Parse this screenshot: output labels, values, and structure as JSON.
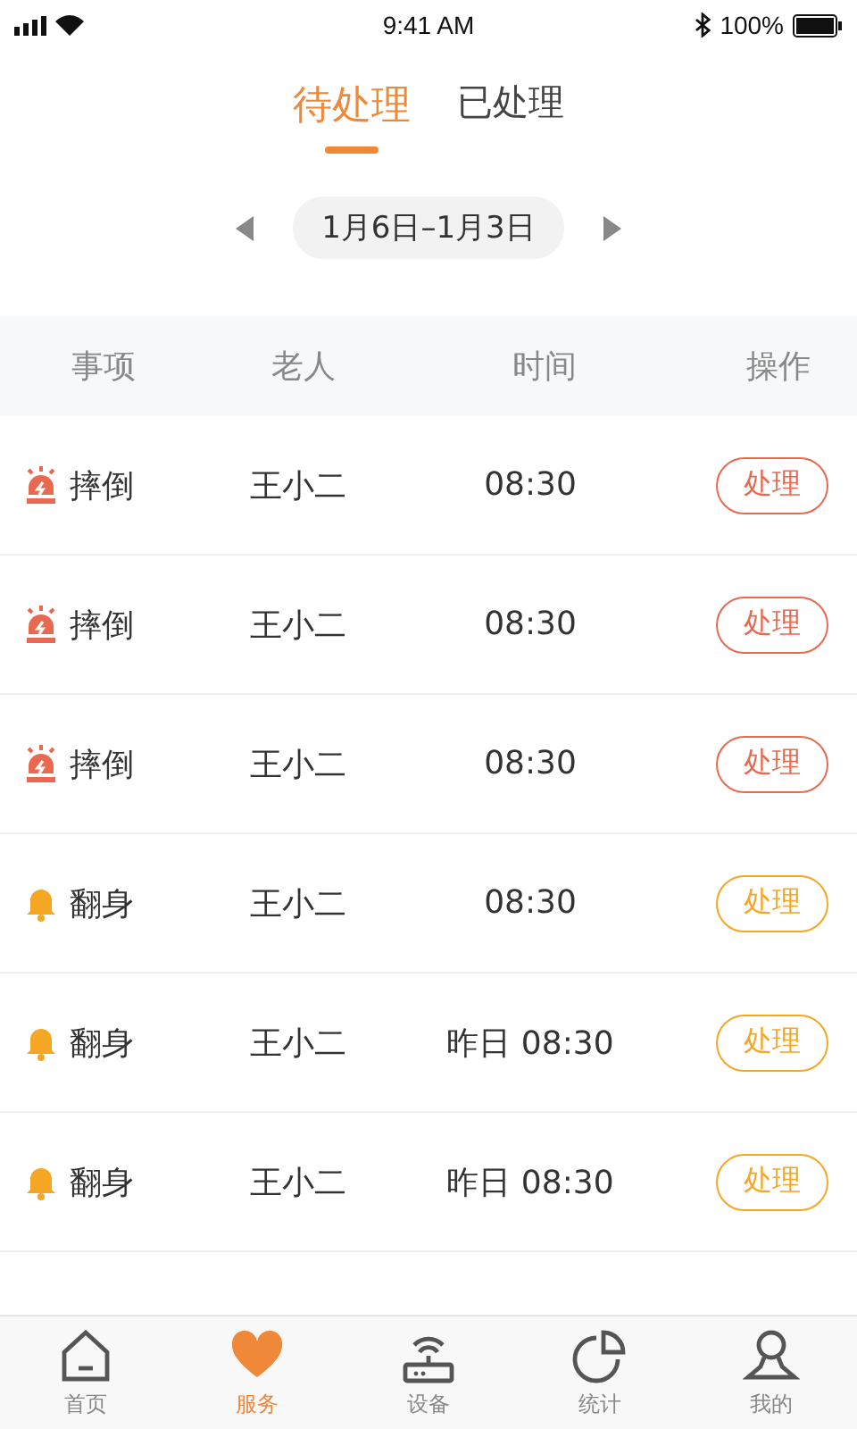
{
  "status_bar": {
    "time": "9:41 AM",
    "battery": "100%"
  },
  "tabs": [
    {
      "label": "待处理",
      "selected": true
    },
    {
      "label": "已处理",
      "selected": false
    }
  ],
  "date_range": {
    "label": "1月6日–1月3日"
  },
  "table": {
    "columns": [
      "事项",
      "老人",
      "时间",
      "操作"
    ],
    "rows": [
      {
        "kind": "alarm",
        "event": "摔倒",
        "elder": "王小二",
        "time": "08:30",
        "action": "处理"
      },
      {
        "kind": "alarm",
        "event": "摔倒",
        "elder": "王小二",
        "time": "08:30",
        "action": "处理"
      },
      {
        "kind": "alarm",
        "event": "摔倒",
        "elder": "王小二",
        "time": "08:30",
        "action": "处理"
      },
      {
        "kind": "bell",
        "event": "翻身",
        "elder": "王小二",
        "time": "08:30",
        "action": "处理"
      },
      {
        "kind": "bell",
        "event": "翻身",
        "elder": "王小二",
        "time": "昨日 08:30",
        "action": "处理"
      },
      {
        "kind": "bell",
        "event": "翻身",
        "elder": "王小二",
        "time": "昨日 08:30",
        "action": "处理"
      }
    ]
  },
  "tab_bar": [
    {
      "kind": "home",
      "label": "首页",
      "selected": false
    },
    {
      "kind": "heart",
      "label": "服务",
      "selected": true
    },
    {
      "kind": "router",
      "label": "设备",
      "selected": false
    },
    {
      "kind": "pie",
      "label": "统计",
      "selected": false
    },
    {
      "kind": "user",
      "label": "我的",
      "selected": false
    }
  ]
}
